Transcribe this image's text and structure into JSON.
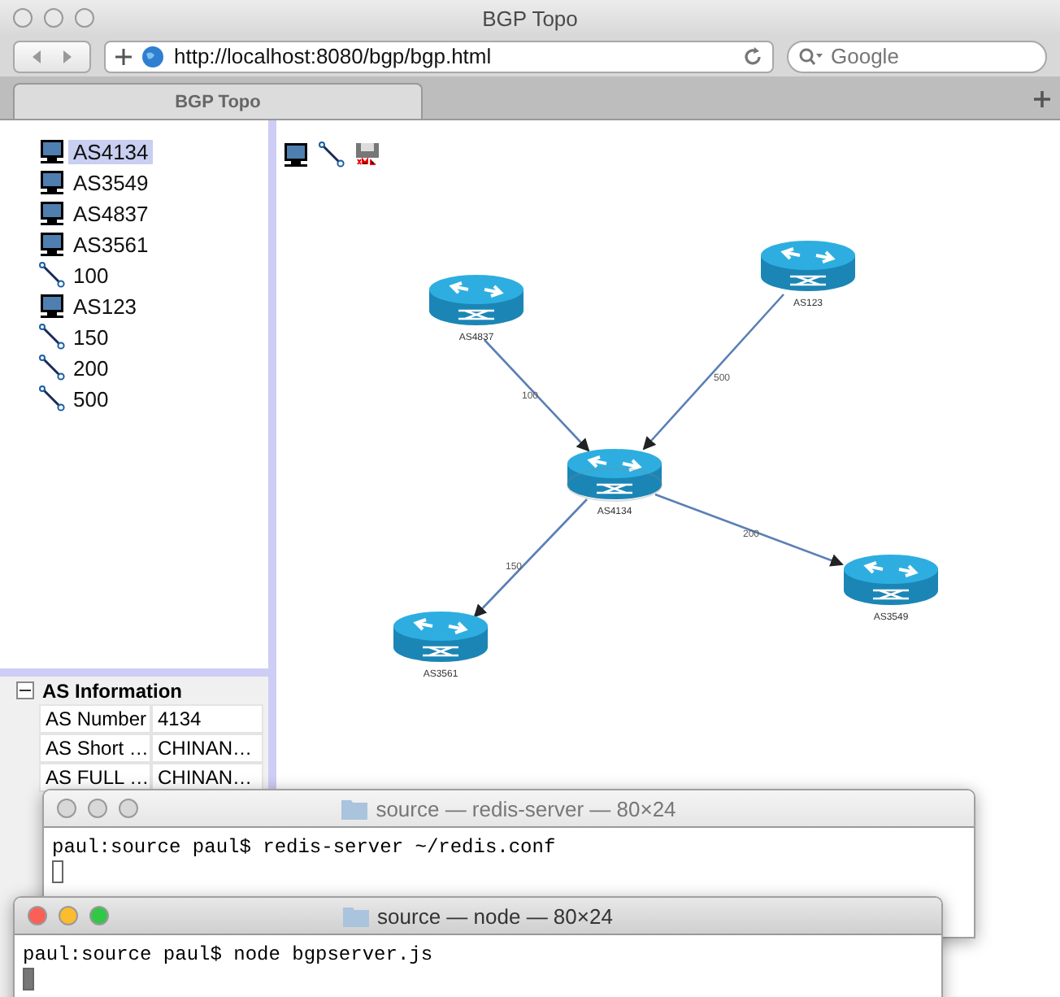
{
  "window": {
    "title": "BGP Topo"
  },
  "toolbar": {
    "url": "http://localhost:8080/bgp/bgp.html",
    "search": {
      "placeholder": "Google"
    }
  },
  "tabs": [
    {
      "label": "BGP Topo",
      "selected": true
    }
  ],
  "sidebar": {
    "items": [
      {
        "kind": "node",
        "label": "AS4134",
        "selected": true
      },
      {
        "kind": "node",
        "label": "AS3549",
        "selected": false
      },
      {
        "kind": "node",
        "label": "AS4837",
        "selected": false
      },
      {
        "kind": "node",
        "label": "AS3561",
        "selected": false
      },
      {
        "kind": "link",
        "label": "100",
        "selected": false
      },
      {
        "kind": "node",
        "label": "AS123",
        "selected": false
      },
      {
        "kind": "link",
        "label": "150",
        "selected": false
      },
      {
        "kind": "link",
        "label": "200",
        "selected": false
      },
      {
        "kind": "link",
        "label": "500",
        "selected": false
      }
    ]
  },
  "info_panel": {
    "title": "AS Information",
    "expanded": true,
    "rows": [
      {
        "property": "AS Number",
        "value": "4134"
      },
      {
        "property": "AS Short …",
        "value": "CHINAN…"
      },
      {
        "property": "AS FULL …",
        "value": "CHINAN…"
      }
    ]
  },
  "graph": {
    "nodes": [
      {
        "label": "AS4837"
      },
      {
        "label": "AS123"
      },
      {
        "label": "AS4134"
      },
      {
        "label": "AS3549"
      },
      {
        "label": "AS3561"
      }
    ],
    "edges": [
      {
        "label": "100"
      },
      {
        "label": "500"
      },
      {
        "label": "200"
      },
      {
        "label": "150"
      }
    ]
  },
  "terminals": [
    {
      "title": "source — redis-server — 80×24",
      "active": false,
      "lines": [
        "paul:source paul$ redis-server ~/redis.conf"
      ]
    },
    {
      "title": "source — node — 80×24",
      "active": true,
      "lines": [
        "paul:source paul$ node bgpserver.js"
      ]
    }
  ]
}
